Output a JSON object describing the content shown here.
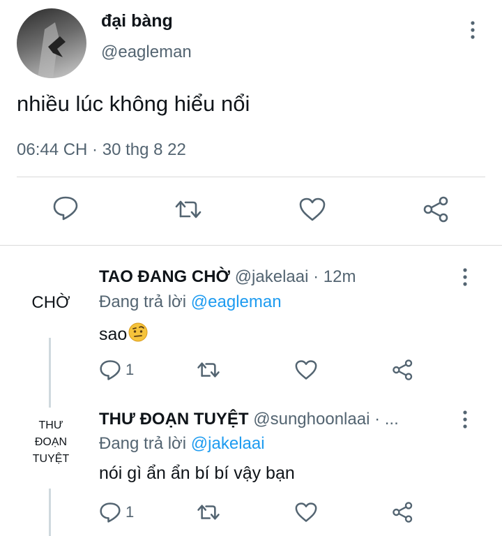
{
  "tweet": {
    "display_name": "đại bàng",
    "handle": "@eagleman",
    "text": "nhiều lúc không hiểu nổi",
    "timestamp": "06:44 CH · 30 thg 8 22",
    "actions": [
      "reply-icon",
      "retweet-icon",
      "like-icon",
      "share-icon"
    ]
  },
  "replies": [
    {
      "avatar_text": "CHỜ",
      "display_name": "TAO ĐANG CHỜ",
      "handle_time": "@jakelaai · 12m",
      "replying_prefix": "Đang trả lời",
      "replying_to": "@eagleman",
      "text": "sao",
      "emoji": "face-with-raised-eyebrow",
      "reply_count": "1"
    },
    {
      "avatar_lines": [
        "THƯ",
        "ĐOẠN",
        "TUYỆT"
      ],
      "display_name": "THƯ ĐOẠN TUYỆT",
      "handle_time": "@sunghoonlaai · ...",
      "replying_prefix": "Đang trả lời",
      "replying_to": "@jakelaai",
      "text": "nói gì ẩn ẩn bí bí vậy bạn",
      "reply_count": "1"
    }
  ],
  "colors": {
    "accent": "#1d9bf0",
    "secondary_text": "#536471",
    "icon": "#536471"
  }
}
